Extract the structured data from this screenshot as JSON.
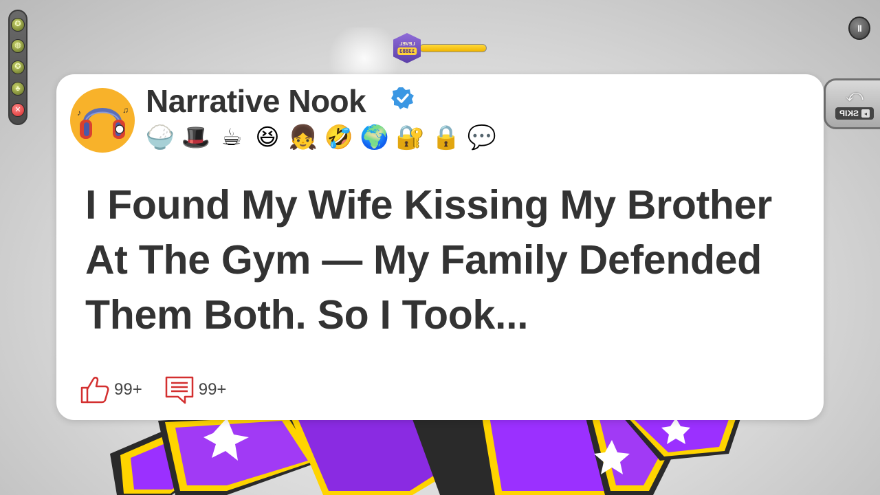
{
  "game": {
    "level_label": "LEVEL",
    "level_number": "13883",
    "level_progress": 1.0,
    "skip_label": "SKIP",
    "pause_symbol": "II",
    "left_toolbar": [
      {
        "icon": "star-icon",
        "symbol": "✪"
      },
      {
        "icon": "globe-icon",
        "symbol": "◍"
      },
      {
        "icon": "star-icon",
        "symbol": "✪"
      },
      {
        "icon": "leaf-icon",
        "symbol": "♣"
      },
      {
        "icon": "close-icon",
        "symbol": "✕"
      }
    ]
  },
  "post": {
    "channel_name": "Narrative Nook",
    "verified": true,
    "emojis": [
      {
        "icon": "rice-bowl-icon",
        "char": "🍚"
      },
      {
        "icon": "uncle-sam-icon",
        "char": "🎩"
      },
      {
        "icon": "coffee-cookies-icon",
        "char": "☕"
      },
      {
        "icon": "laughing-ha-icon",
        "char": "😆"
      },
      {
        "icon": "girl-character-icon",
        "char": "👧"
      },
      {
        "icon": "lmao-icon",
        "char": "🤣"
      },
      {
        "icon": "globe-plane-icon",
        "char": "🌍"
      },
      {
        "icon": "padlock-key-icon",
        "char": "🔐"
      },
      {
        "icon": "padlock-icon",
        "char": "🔒"
      },
      {
        "icon": "speech-doodle-icon",
        "char": "💬"
      }
    ],
    "title": "I Found My Wife Kissing My Brother At The Gym — My Family Defended Them Both. So I Took...",
    "likes": "99+",
    "comments": "99+"
  },
  "colors": {
    "card_bg": "#ffffff",
    "text_dark": "#333333",
    "icon_red": "#d32f2f",
    "verified_blue": "#3b97e3",
    "avatar_bg": "#f8b22a",
    "block_purple": "#8a2be2",
    "block_yellow": "#ffd400"
  }
}
